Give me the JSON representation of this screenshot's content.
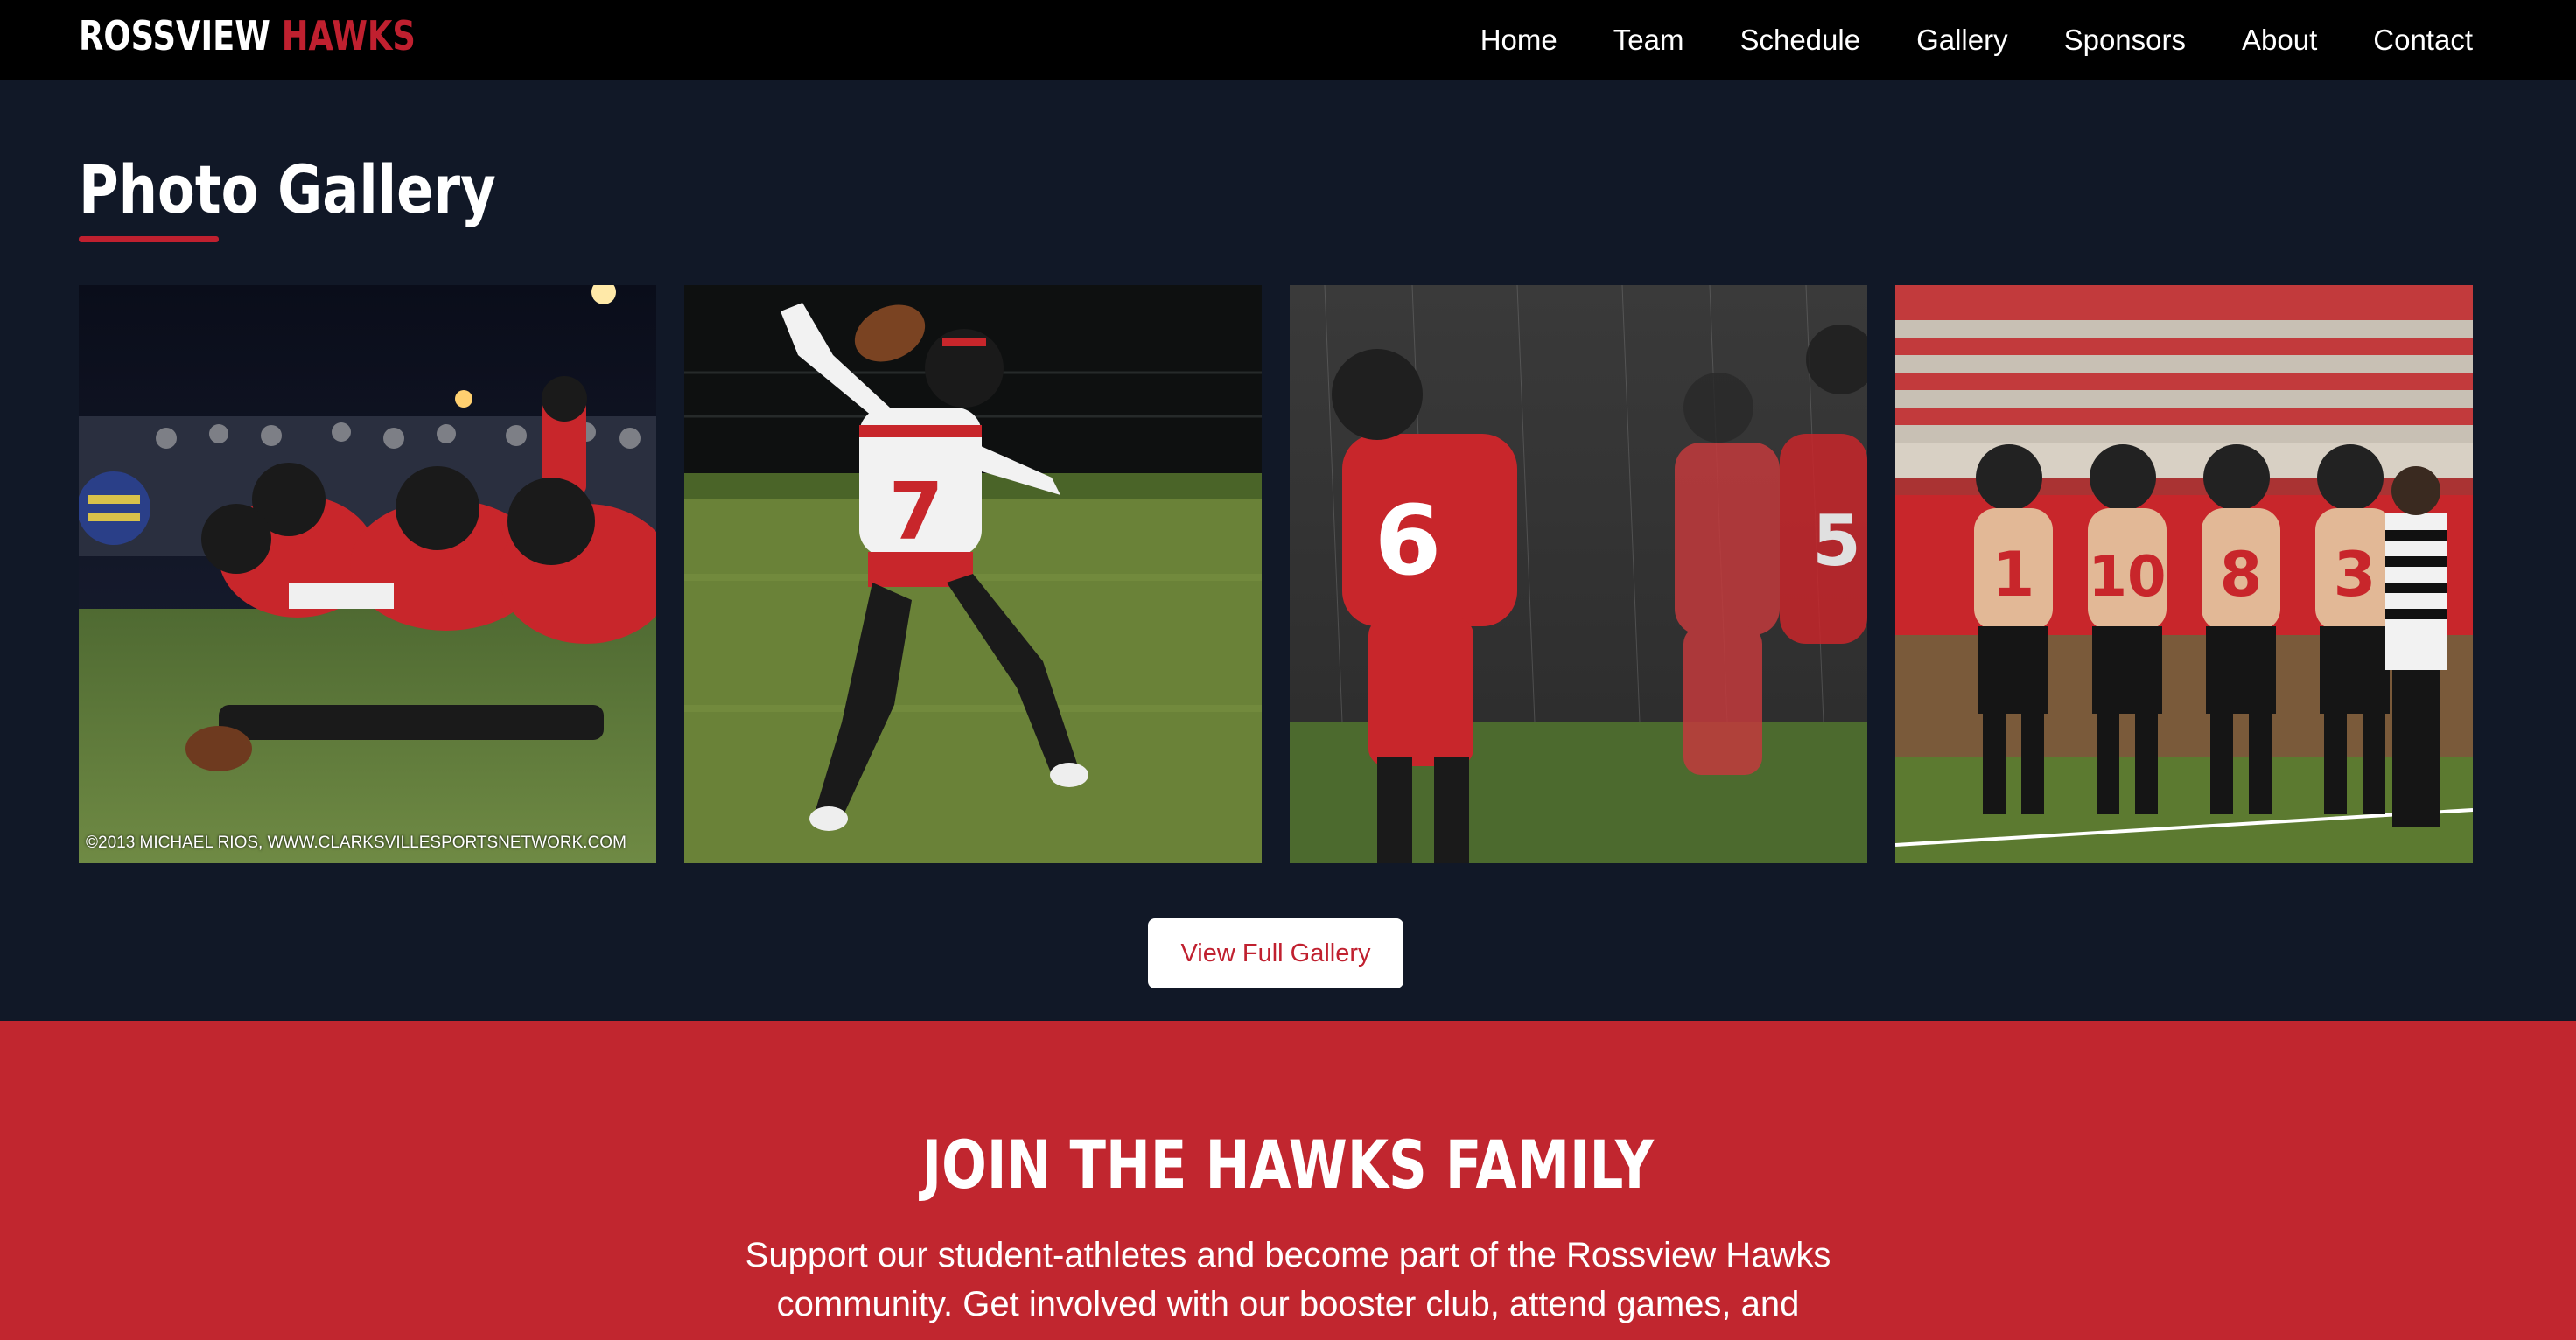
{
  "nav": {
    "brand_part1": "ROSSVIEW",
    "brand_part2": "HAWKS",
    "links": [
      "Home",
      "Team",
      "Schedule",
      "Gallery",
      "Sponsors",
      "About",
      "Contact"
    ]
  },
  "gallery": {
    "title": "Photo Gallery",
    "photos": [
      {
        "description": "offensive-line-at-snap",
        "watermark": "©2013 MICHAEL RIOS, WWW.CLARKSVILLESPORTSNETWORK.COM"
      },
      {
        "description": "quarterback-throwing-number-7"
      },
      {
        "description": "players-in-rain-number-6"
      },
      {
        "description": "four-captains-at-coin-toss"
      }
    ],
    "view_button": "View Full Gallery"
  },
  "join": {
    "title": "JOIN THE HAWKS FAMILY",
    "text": "Support our student-athletes and become part of the Rossview Hawks community. Get involved with our booster club, attend games, and"
  },
  "colors": {
    "accent": "#c0202f",
    "nav_bg": "#000000",
    "section_bg": "#111827",
    "join_bg": "#c1262f"
  }
}
